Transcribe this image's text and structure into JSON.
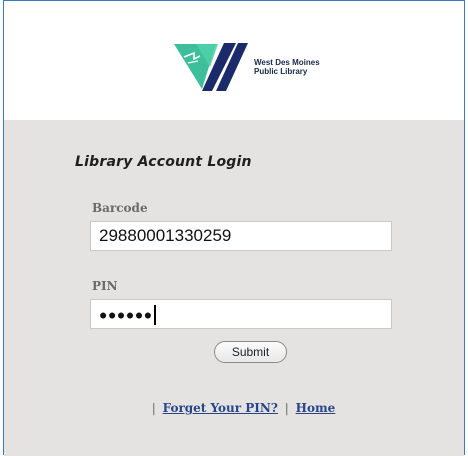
{
  "library": {
    "name_line1": "West Des Moines",
    "name_line2": "Public Library"
  },
  "login": {
    "title": "Library Account Login",
    "barcode_label": "Barcode",
    "barcode_value": "29880001330259",
    "pin_label": "PIN",
    "pin_masked": "●●●●●●",
    "submit_label": "Submit"
  },
  "links": {
    "separator": "|",
    "forgot_pin": "Forget Your PIN?",
    "home": "Home"
  },
  "colors": {
    "logo_green": "#3cbf9a",
    "logo_navy": "#1b2a6b",
    "panel_bg": "#e4e3e1",
    "link": "#28458a",
    "frame_border": "#3d78c8"
  },
  "icons": {
    "logo": "west-des-moines-library-logo"
  }
}
